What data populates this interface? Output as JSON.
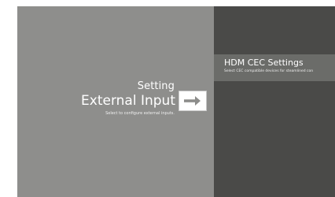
{
  "left_panel": {
    "section_label": "Setting",
    "title": "External Input",
    "description": "Select to configure external inputs.",
    "action_icon": "arrow-right-icon"
  },
  "right_panel": {
    "item_title": "HDM CEC Settings",
    "item_description": "Select CEC compatible devices for steamlined con"
  },
  "colors": {
    "left_background": "#8e8e8c",
    "right_background": "#4a4a48",
    "highlight_background": "#6b6c69",
    "text": "#ffffff",
    "button_background": "#ffffff",
    "arrow": "#8d8d8b"
  }
}
